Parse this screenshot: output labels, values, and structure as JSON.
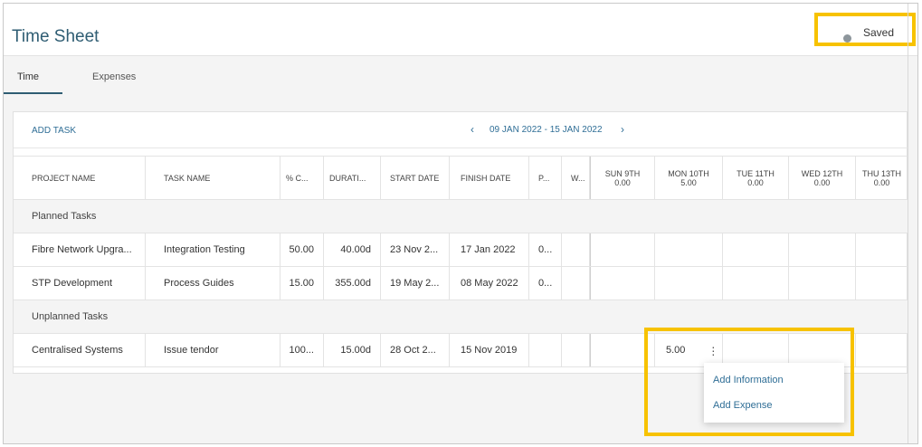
{
  "app": {
    "title": "Time Sheet",
    "status": "Saved"
  },
  "tabs": [
    {
      "label": "Time"
    },
    {
      "label": "Expenses"
    }
  ],
  "toolbar": {
    "add_task": "ADD TASK",
    "prev": "‹",
    "date_range": "09 JAN 2022 - 15 JAN 2022",
    "next": "›"
  },
  "table": {
    "headers": [
      "PROJECT NAME",
      "TASK NAME",
      "% C...",
      "DURATI...",
      "START DATE",
      "FINISH DATE",
      "P...",
      "W..."
    ],
    "days": [
      {
        "label": "SUN 9TH",
        "total": "0.00"
      },
      {
        "label": "MON 10TH",
        "total": "5.00"
      },
      {
        "label": "TUE 11TH",
        "total": "0.00"
      },
      {
        "label": "WED 12TH",
        "total": "0.00"
      },
      {
        "label": "THU 13TH",
        "total": "0.00"
      }
    ],
    "groups": [
      {
        "label": "Planned Tasks",
        "rows": [
          {
            "project": "Fibre Network Upgra...",
            "task": "Integration Testing",
            "pct": "50.00",
            "duration": "40.00d",
            "start": "23 Nov 2...",
            "finish": "17 Jan 2022",
            "p": "0...",
            "w": "",
            "entries": [
              "",
              "",
              "",
              "",
              ""
            ]
          },
          {
            "project": "STP Development",
            "task": "Process Guides",
            "pct": "15.00",
            "duration": "355.00d",
            "start": "19 May 2...",
            "finish": "08 May 2022",
            "p": "0...",
            "w": "",
            "entries": [
              "",
              "",
              "",
              "",
              ""
            ]
          }
        ]
      },
      {
        "label": "Unplanned Tasks",
        "rows": [
          {
            "project": "Centralised Systems",
            "task": "Issue tendor",
            "pct": "100...",
            "duration": "15.00d",
            "start": "28 Oct 2...",
            "finish": "15 Nov 2019",
            "p": "",
            "w": "",
            "entries": [
              "",
              "5.00",
              "",
              "",
              ""
            ]
          }
        ]
      }
    ]
  },
  "context_menu": {
    "items": [
      "Add Information",
      "Add Expense"
    ]
  },
  "colors": {
    "title": "#2f5d73",
    "link": "#2f6e96",
    "highlight": "#f7c200"
  }
}
